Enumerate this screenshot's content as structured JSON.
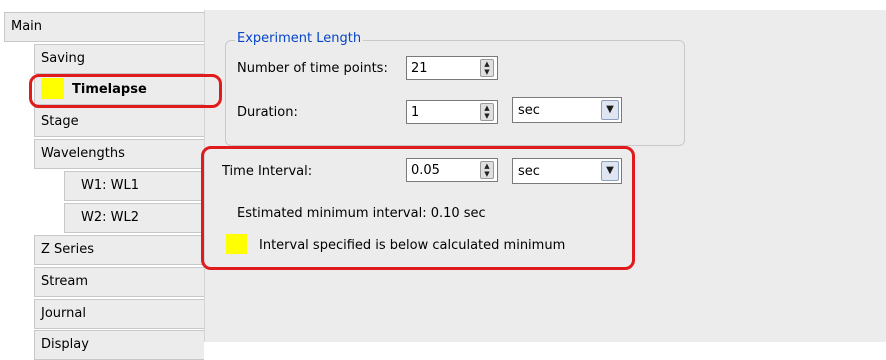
{
  "sidebar": {
    "items": [
      {
        "label": "Main"
      },
      {
        "label": "Saving"
      },
      {
        "label": "Timelapse"
      },
      {
        "label": "Stage"
      },
      {
        "label": "Wavelengths"
      },
      {
        "label": "W1: WL1"
      },
      {
        "label": "W2: WL2"
      },
      {
        "label": "Z Series"
      },
      {
        "label": "Stream"
      },
      {
        "label": "Journal"
      },
      {
        "label": "Display"
      }
    ],
    "active_item": "Timelapse"
  },
  "experiment_length": {
    "title": "Experiment Length",
    "time_points": {
      "label": "Number of time points:",
      "value": "21"
    },
    "duration": {
      "label": "Duration:",
      "value": "1",
      "unit": "sec"
    }
  },
  "time_interval": {
    "label": "Time Interval:",
    "value": "0.05",
    "unit": "sec",
    "estimated": "Estimated minimum interval: 0.10 sec",
    "warning": "Interval specified is below calculated minimum"
  },
  "colors": {
    "highlight": "#e01b1b",
    "warning_swatch": "#ffff00",
    "group_title": "#0645c8",
    "panel_background": "#ececec"
  }
}
